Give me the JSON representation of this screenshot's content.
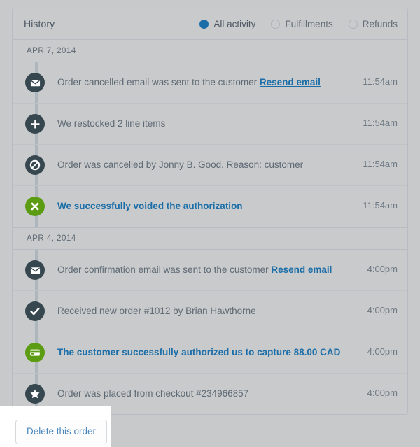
{
  "card": {
    "title": "History",
    "filters": [
      {
        "label": "All activity",
        "selected": true,
        "name": "filter-all-activity"
      },
      {
        "label": "Fulfillments",
        "selected": false,
        "name": "filter-fulfillments"
      },
      {
        "label": "Refunds",
        "selected": false,
        "name": "filter-refunds"
      }
    ]
  },
  "groups": [
    {
      "date": "APR 7, 2014",
      "events": [
        {
          "icon": "envelope-icon",
          "icon_color": "#36474f",
          "text": "Order cancelled email was sent to the customer ",
          "link": "Resend email",
          "highlight": false,
          "time": "11:54am"
        },
        {
          "icon": "plus-icon",
          "icon_color": "#36474f",
          "text": "We restocked 2 line items",
          "link": "",
          "highlight": false,
          "time": "11:54am"
        },
        {
          "icon": "no-entry-icon",
          "icon_color": "#36474f",
          "text": "Order was cancelled by Jonny B. Good. Reason: customer",
          "link": "",
          "highlight": false,
          "time": "11:54am"
        },
        {
          "icon": "x-mark-icon",
          "icon_color": "#5c9c12",
          "text": "We successfully voided the authorization",
          "link": "",
          "highlight": true,
          "time": "11:54am"
        }
      ]
    },
    {
      "date": "APR 4, 2014",
      "events": [
        {
          "icon": "envelope-icon",
          "icon_color": "#36474f",
          "text": "Order confirmation email was sent to the customer ",
          "link": "Resend email",
          "highlight": false,
          "time": "4:00pm"
        },
        {
          "icon": "check-circle-icon",
          "icon_color": "#36474f",
          "text": "Received new order #1012 by Brian Hawthorne",
          "link": "",
          "highlight": false,
          "time": "4:00pm"
        },
        {
          "icon": "credit-card-icon",
          "icon_color": "#5c9c12",
          "text": "The customer successfully authorized us to capture 88.00 CAD",
          "link": "",
          "highlight": true,
          "time": "4:00pm"
        },
        {
          "icon": "star-icon",
          "icon_color": "#36474f",
          "text": "Order was placed from checkout #234966857",
          "link": "",
          "highlight": false,
          "time": "4:00pm"
        }
      ]
    }
  ],
  "footer": {
    "delete_label": "Delete this order"
  },
  "colors": {
    "page_background": "#c8c9cb",
    "card_background": "#c9cacc",
    "card_border": "#b6bcc2",
    "accent_blue": "#1b6ea8",
    "icon_dark": "#36474f",
    "icon_green": "#5c9c12",
    "rail": "#adb5bd",
    "text": "#5e6a74"
  }
}
